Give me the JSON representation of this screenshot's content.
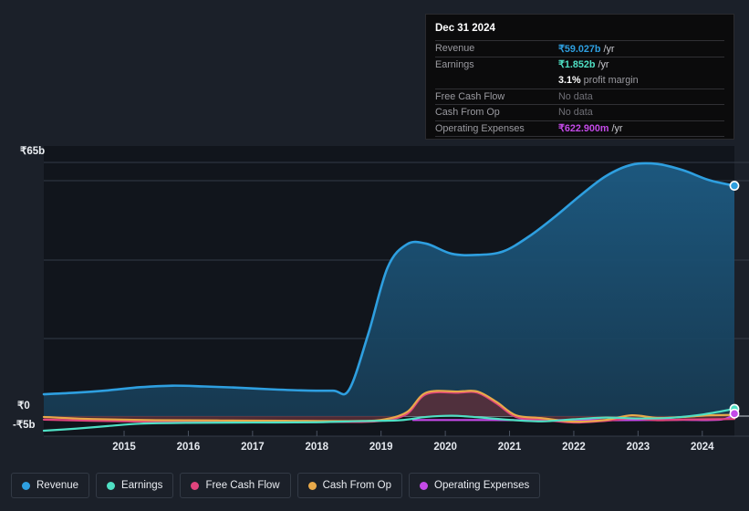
{
  "chart_data": {
    "type": "area",
    "title": "",
    "xlabel": "",
    "ylabel": "",
    "currency_symbol": "₹",
    "grid": true,
    "legend_position": "bottom",
    "ylim": [
      -5,
      65
    ],
    "y_ticks": [
      {
        "label": "₹65b",
        "value": 65
      },
      {
        "label": "₹0",
        "value": 0
      },
      {
        "label": "-₹5b",
        "value": -5
      }
    ],
    "x_ticks": [
      "2015",
      "2016",
      "2017",
      "2018",
      "2019",
      "2020",
      "2021",
      "2022",
      "2023",
      "2024"
    ],
    "x_range": [
      "2014.25",
      "2025.0"
    ],
    "series": [
      {
        "name": "Revenue",
        "color": "#2e9fe0",
        "fill": "#173d57",
        "x": [
          2014.25,
          2014.75,
          2015.25,
          2015.75,
          2016.25,
          2016.75,
          2017.25,
          2017.75,
          2018.25,
          2018.75,
          2019.0,
          2019.3,
          2019.6,
          2019.9,
          2020.2,
          2020.6,
          2021.0,
          2021.4,
          2021.8,
          2022.2,
          2022.6,
          2023.0,
          2023.4,
          2023.8,
          2024.2,
          2024.6,
          2025.0
        ],
        "values": [
          5.6,
          6.0,
          6.6,
          7.4,
          7.8,
          7.6,
          7.3,
          6.9,
          6.6,
          6.5,
          6.7,
          21.0,
          38.0,
          44.0,
          44.2,
          41.6,
          41.3,
          42.2,
          46.0,
          51.0,
          56.5,
          61.5,
          64.4,
          64.6,
          63.0,
          60.5,
          59.027
        ]
      },
      {
        "name": "Earnings",
        "color": "#4fe0c4",
        "x": [
          2014.25,
          2014.75,
          2015.25,
          2015.75,
          2016.5,
          2017.5,
          2018.5,
          2019.2,
          2019.8,
          2020.2,
          2020.6,
          2021.0,
          2021.5,
          2022.0,
          2022.5,
          2023.0,
          2023.5,
          2024.0,
          2024.5,
          2025.0
        ],
        "values": [
          -5.0,
          -4.3,
          -3.4,
          -2.6,
          -2.3,
          -2.2,
          -2.1,
          -1.7,
          -1.4,
          -0.3,
          0.1,
          -0.4,
          -1.3,
          -1.8,
          -1.1,
          -0.5,
          -0.8,
          -0.6,
          0.4,
          1.852
        ]
      },
      {
        "name": "Free Cash Flow",
        "color": "#e0447d",
        "fill": "#5b2f39",
        "x": [
          2014.25,
          2015.0,
          2016.0,
          2017.0,
          2018.0,
          2019.0,
          2019.5,
          2019.9,
          2020.2,
          2020.7,
          2021.0,
          2021.3,
          2021.6,
          2022.0,
          2022.5,
          2023.0,
          2023.4,
          2023.8,
          2024.2,
          2024.6,
          2025.0
        ],
        "values": [
          -1.2,
          -1.6,
          -1.9,
          -1.9,
          -1.9,
          -2.0,
          -1.6,
          0.5,
          5.6,
          6.0,
          6.0,
          3.2,
          -0.3,
          -1.2,
          -2.2,
          -1.6,
          -0.8,
          -1.4,
          -1.2,
          -1.1,
          -1.0
        ]
      },
      {
        "name": "Cash From Op",
        "color": "#e8a94a",
        "x": [
          2014.25,
          2015.0,
          2016.0,
          2017.0,
          2018.0,
          2019.0,
          2019.5,
          2019.9,
          2020.2,
          2020.7,
          2021.0,
          2021.3,
          2021.6,
          2022.0,
          2022.5,
          2023.0,
          2023.4,
          2023.8,
          2024.2,
          2024.6,
          2025.0
        ],
        "values": [
          -0.3,
          -1.0,
          -1.4,
          -1.5,
          -1.6,
          -1.7,
          -1.3,
          1.0,
          6.0,
          6.3,
          6.3,
          3.6,
          0.2,
          -0.7,
          -1.9,
          -1.3,
          0.2,
          -0.6,
          -0.3,
          0.2,
          0.3
        ]
      },
      {
        "name": "Operating Expenses",
        "color": "#c44ae8",
        "x": [
          2020.0,
          2020.6,
          2021.2,
          2021.8,
          2022.4,
          2023.0,
          2023.6,
          2024.2,
          2024.8,
          2025.0
        ],
        "values": [
          -1.35,
          -1.35,
          -1.35,
          -1.4,
          -1.35,
          -1.4,
          -1.35,
          -1.3,
          -1.2,
          0.6229
        ]
      }
    ],
    "endpoint_markers": [
      {
        "series": "Revenue",
        "value": 59.027
      },
      {
        "series": "Earnings",
        "value": 1.852
      },
      {
        "series": "Operating Expenses",
        "value": 0.6229
      }
    ]
  },
  "tooltip": {
    "title": "Dec 31 2024",
    "rows": [
      {
        "label": "Revenue",
        "value": "₹59.027b",
        "unit": "/yr",
        "color": "#2e9fe0",
        "no_data": false
      },
      {
        "label": "Earnings",
        "value": "₹1.852b",
        "unit": "/yr",
        "color": "#4fe0c4",
        "no_data": false
      }
    ],
    "margin_row": {
      "value": "3.1%",
      "text": "profit margin"
    },
    "rows2": [
      {
        "label": "Free Cash Flow",
        "value": "No data",
        "unit": "",
        "color": "#6f6f76",
        "no_data": true
      },
      {
        "label": "Cash From Op",
        "value": "No data",
        "unit": "",
        "color": "#6f6f76",
        "no_data": true
      },
      {
        "label": "Operating Expenses",
        "value": "₹622.900m",
        "unit": "/yr",
        "color": "#c44ae8",
        "no_data": false
      }
    ]
  },
  "legend": {
    "items": [
      {
        "label": "Revenue",
        "color": "#2e9fe0"
      },
      {
        "label": "Earnings",
        "color": "#4fe0c4"
      },
      {
        "label": "Free Cash Flow",
        "color": "#e0447d"
      },
      {
        "label": "Cash From Op",
        "color": "#e8a94a"
      },
      {
        "label": "Operating Expenses",
        "color": "#c44ae8"
      }
    ]
  }
}
